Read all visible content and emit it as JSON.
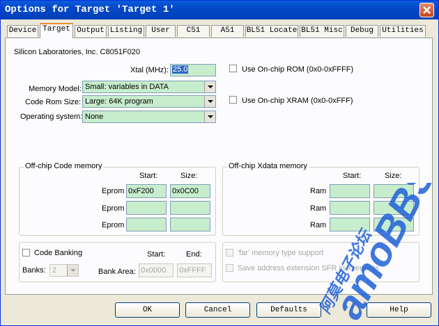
{
  "window": {
    "title": "Options for Target 'Target 1'",
    "close_label": "close"
  },
  "tabs": [
    {
      "label": "Device",
      "active": false
    },
    {
      "label": "Target",
      "active": true
    },
    {
      "label": "Output",
      "active": false
    },
    {
      "label": "Listing",
      "active": false
    },
    {
      "label": "User",
      "active": false
    },
    {
      "label": "C51",
      "active": false
    },
    {
      "label": "A51",
      "active": false
    },
    {
      "label": "BL51 Locate",
      "active": false
    },
    {
      "label": "BL51 Misc",
      "active": false
    },
    {
      "label": "Debug",
      "active": false
    },
    {
      "label": "Utilities",
      "active": false
    }
  ],
  "target": {
    "device_name": "Silicon Laboratories, Inc. C8051F020",
    "xtal_label": "Xtal (MHz):",
    "xtal_value": "25.0",
    "use_onchip_rom_label": "Use On-chip ROM (0x0-0xFFFF)",
    "use_onchip_xram_label": "Use On-chip XRAM (0x0-0xFFF)",
    "memory_model_label": "Memory Model:",
    "memory_model_value": "Small: variables in DATA",
    "code_rom_size_label": "Code Rom Size:",
    "code_rom_size_value": "Large: 64K program",
    "operating_system_label": "Operating system:",
    "operating_system_value": "None"
  },
  "offchip_code": {
    "title": "Off-chip Code memory",
    "start_header": "Start:",
    "size_header": "Size:",
    "rows": [
      {
        "label": "Eprom",
        "start": "0xF200",
        "size": "0x0C00"
      },
      {
        "label": "Eprom",
        "start": "",
        "size": ""
      },
      {
        "label": "Eprom",
        "start": "",
        "size": ""
      }
    ]
  },
  "offchip_xdata": {
    "title": "Off-chip Xdata memory",
    "start_header": "Start:",
    "size_header": "Size:",
    "rows": [
      {
        "label": "Ram",
        "start": "",
        "size": ""
      },
      {
        "label": "Ram",
        "start": "",
        "size": ""
      },
      {
        "label": "Ram",
        "start": "",
        "size": ""
      }
    ]
  },
  "banking": {
    "code_banking_label": "Code Banking",
    "start_header": "Start:",
    "end_header": "End:",
    "banks_label": "Banks:",
    "banks_value": "2",
    "bank_area_label": "Bank Area:",
    "bank_area_start": "0x0000",
    "bank_area_end": "0xFFFF"
  },
  "options": {
    "far_memory_label": "'far' memory type support",
    "save_address_label": "Save address extension SFR in interrupts"
  },
  "buttons": {
    "ok": "OK",
    "cancel": "Cancel",
    "defaults": "Defaults",
    "help": "Help"
  },
  "watermark": {
    "brand": "amoBBS",
    "subtitle": "阿莫电子论坛"
  },
  "colors": {
    "titlebar": "#0548c7",
    "field_bg": "#c7edcc",
    "active_tab_accent": "#e68b2c",
    "watermark": "#1f5fd6"
  }
}
